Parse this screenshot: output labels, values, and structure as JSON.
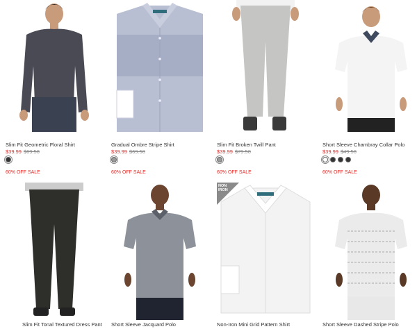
{
  "products": [
    {
      "name": "Slim Fit Geometric Floral Shirt",
      "sale_price": "$39.99",
      "orig_price": "$69.50",
      "promo": "60% OFF SALE"
    },
    {
      "name": "Gradual Ombre Stripe Shirt",
      "sale_price": "$39.99",
      "orig_price": "$69.50",
      "promo": "60% OFF SALE"
    },
    {
      "name": "Slim Fit Broken Twill Pant",
      "sale_price": "$39.99",
      "orig_price": "$79.50",
      "promo": "60% OFF SALE"
    },
    {
      "name": "Short Sleeve Chambray Collar Polo",
      "sale_price": "$39.99",
      "orig_price": "$49.50",
      "promo": "60% OFF SALE"
    },
    {
      "name": "Slim Fit Tonal Textured Dress Pant"
    },
    {
      "name": "Short Sleeve Jacquard Polo"
    },
    {
      "name": "Non-Iron Mini Grid Pattern Shirt",
      "badge": "NON\nIRON"
    },
    {
      "name": "Short Sleeve Dashed Stripe Polo"
    }
  ],
  "colors": {
    "sale": "#e02b27",
    "original": "#888888"
  }
}
